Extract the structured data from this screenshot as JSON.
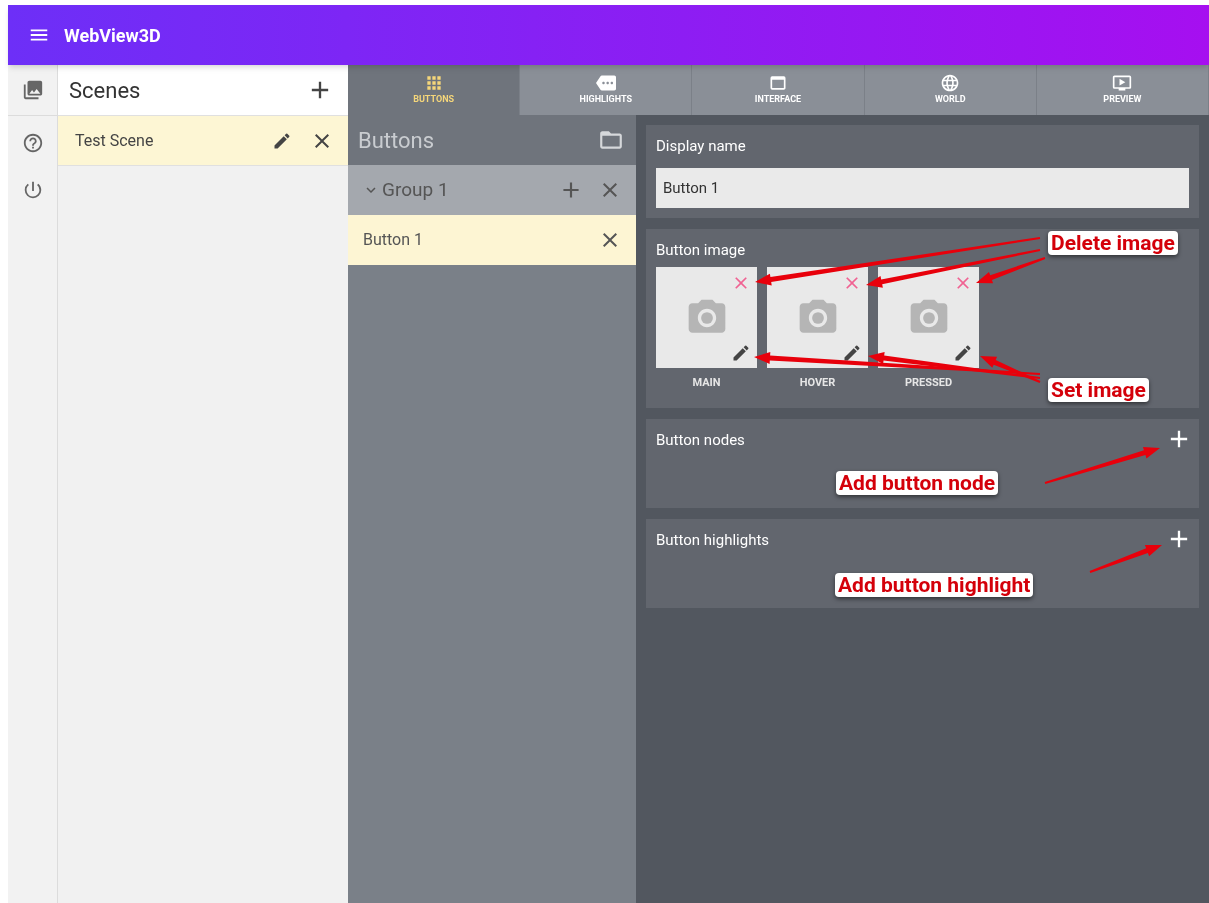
{
  "app_bar": {
    "title": "WebView3D"
  },
  "scenes_panel": {
    "title": "Scenes",
    "scenes": [
      {
        "name": "Test Scene",
        "selected": true
      }
    ]
  },
  "tabs": [
    {
      "label": "BUTTONS",
      "selected": true
    },
    {
      "label": "HIGHLIGHTS",
      "selected": false
    },
    {
      "label": "INTERFACE",
      "selected": false
    },
    {
      "label": "WORLD",
      "selected": false
    },
    {
      "label": "PREVIEW",
      "selected": false
    }
  ],
  "buttons_panel": {
    "title": "Buttons",
    "groups": [
      {
        "name": "Group 1",
        "expanded": true,
        "buttons": [
          {
            "name": "Button 1",
            "selected": true
          }
        ]
      }
    ]
  },
  "editor": {
    "display_name": {
      "label": "Display name",
      "value": "Button 1"
    },
    "button_image": {
      "title": "Button image",
      "images": [
        {
          "label": "MAIN"
        },
        {
          "label": "HOVER"
        },
        {
          "label": "PRESSED"
        }
      ]
    },
    "button_nodes": {
      "title": "Button nodes"
    },
    "button_highlights": {
      "title": "Button highlights"
    }
  },
  "annotations": [
    {
      "text": "Delete image"
    },
    {
      "text": "Set image"
    },
    {
      "text": "Add button node"
    },
    {
      "text": "Add button highlight"
    }
  ]
}
